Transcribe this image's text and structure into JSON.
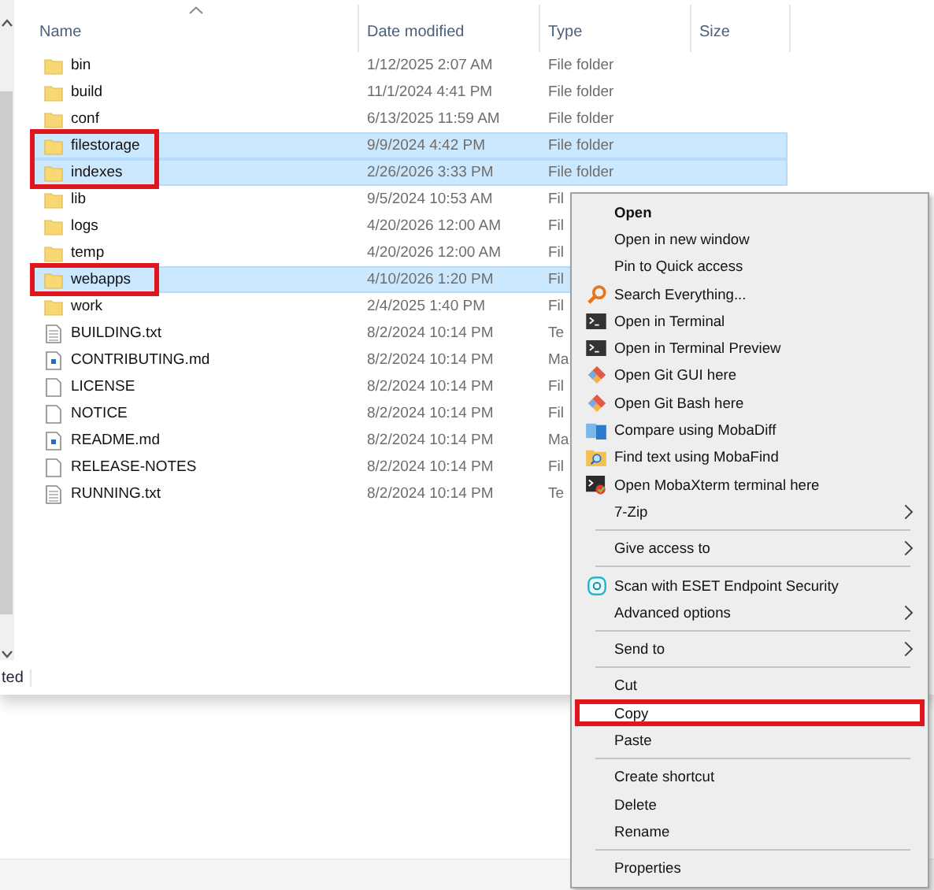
{
  "columns": [
    {
      "label": "Name",
      "sorted": true
    },
    {
      "label": "Date modified",
      "sorted": false
    },
    {
      "label": "Type",
      "sorted": false
    },
    {
      "label": "Size",
      "sorted": false
    }
  ],
  "files": [
    {
      "name": "bin",
      "date": "1/12/2025 2:07 AM",
      "type": "File folder",
      "kind": "folder",
      "selected": false,
      "annotated": false
    },
    {
      "name": "build",
      "date": "11/1/2024 4:41 PM",
      "type": "File folder",
      "kind": "folder",
      "selected": false,
      "annotated": false
    },
    {
      "name": "conf",
      "date": "6/13/2025 11:59 AM",
      "type": "File folder",
      "kind": "folder",
      "selected": false,
      "annotated": false
    },
    {
      "name": "filestorage",
      "date": "9/9/2024 4:42 PM",
      "type": "File folder",
      "kind": "folder",
      "selected": true,
      "annotated": true
    },
    {
      "name": "indexes",
      "date": "2/26/2026 3:33 PM",
      "type": "File folder",
      "kind": "folder",
      "selected": true,
      "annotated": true
    },
    {
      "name": "lib",
      "date": "9/5/2024 10:53 AM",
      "type": "Fil",
      "kind": "folder",
      "selected": false,
      "annotated": false
    },
    {
      "name": "logs",
      "date": "4/20/2026 12:00 AM",
      "type": "Fil",
      "kind": "folder",
      "selected": false,
      "annotated": false
    },
    {
      "name": "temp",
      "date": "4/20/2026 12:00 AM",
      "type": "Fil",
      "kind": "folder",
      "selected": false,
      "annotated": false
    },
    {
      "name": "webapps",
      "date": "4/10/2026 1:20 PM",
      "type": "Fil",
      "kind": "folder",
      "selected": true,
      "annotated": true
    },
    {
      "name": "work",
      "date": "2/4/2025 1:40 PM",
      "type": "Fil",
      "kind": "folder",
      "selected": false,
      "annotated": false
    },
    {
      "name": "BUILDING.txt",
      "date": "8/2/2024 10:14 PM",
      "type": "Te",
      "kind": "text",
      "selected": false,
      "annotated": false
    },
    {
      "name": "CONTRIBUTING.md",
      "date": "8/2/2024 10:14 PM",
      "type": "Ma",
      "kind": "markdown",
      "selected": false,
      "annotated": false
    },
    {
      "name": "LICENSE",
      "date": "8/2/2024 10:14 PM",
      "type": "Fil",
      "kind": "blank",
      "selected": false,
      "annotated": false
    },
    {
      "name": "NOTICE",
      "date": "8/2/2024 10:14 PM",
      "type": "Fil",
      "kind": "blank",
      "selected": false,
      "annotated": false
    },
    {
      "name": "README.md",
      "date": "8/2/2024 10:14 PM",
      "type": "Ma",
      "kind": "markdown",
      "selected": false,
      "annotated": false
    },
    {
      "name": "RELEASE-NOTES",
      "date": "8/2/2024 10:14 PM",
      "type": "Fil",
      "kind": "blank",
      "selected": false,
      "annotated": false
    },
    {
      "name": "RUNNING.txt",
      "date": "8/2/2024 10:14 PM",
      "type": "Te",
      "kind": "text",
      "selected": false,
      "annotated": false
    }
  ],
  "status_bar": {
    "text": "ted"
  },
  "context_menu": [
    {
      "kind": "item",
      "label": "Open",
      "default": true,
      "submenu": false,
      "selected": false,
      "annotated": false
    },
    {
      "kind": "item",
      "label": "Open in new window",
      "default": false,
      "submenu": false,
      "selected": false,
      "annotated": false
    },
    {
      "kind": "item",
      "label": "Pin to Quick access",
      "default": false,
      "submenu": false,
      "selected": false,
      "annotated": false
    },
    {
      "kind": "search",
      "label": "Search Everything...",
      "default": false,
      "submenu": false,
      "selected": false,
      "annotated": false
    },
    {
      "kind": "terminal",
      "label": "Open in Terminal",
      "default": false,
      "submenu": false,
      "selected": false,
      "annotated": false
    },
    {
      "kind": "terminal",
      "label": "Open in Terminal Preview",
      "default": false,
      "submenu": false,
      "selected": false,
      "annotated": false
    },
    {
      "kind": "git",
      "label": "Open Git GUI here",
      "default": false,
      "submenu": false,
      "selected": false,
      "annotated": false
    },
    {
      "kind": "git",
      "label": "Open Git Bash here",
      "default": false,
      "submenu": false,
      "selected": false,
      "annotated": false
    },
    {
      "kind": "compare",
      "label": "Compare using MobaDiff",
      "default": false,
      "submenu": false,
      "selected": false,
      "annotated": false
    },
    {
      "kind": "find",
      "label": "Find text using MobaFind",
      "default": false,
      "submenu": false,
      "selected": false,
      "annotated": false
    },
    {
      "kind": "mobaxterm",
      "label": "Open MobaXterm terminal here",
      "default": false,
      "submenu": false,
      "selected": false,
      "annotated": false
    },
    {
      "kind": "item",
      "label": "7-Zip",
      "default": false,
      "submenu": true,
      "selected": false,
      "annotated": false
    },
    {
      "kind": "separator"
    },
    {
      "kind": "item",
      "label": "Give access to",
      "default": false,
      "submenu": true,
      "selected": false,
      "annotated": false
    },
    {
      "kind": "separator"
    },
    {
      "kind": "eset",
      "label": "Scan with ESET Endpoint Security",
      "default": false,
      "submenu": false,
      "selected": false,
      "annotated": false
    },
    {
      "kind": "item",
      "label": "Advanced options",
      "default": false,
      "submenu": true,
      "selected": false,
      "annotated": false
    },
    {
      "kind": "separator"
    },
    {
      "kind": "item",
      "label": "Send to",
      "default": false,
      "submenu": true,
      "selected": false,
      "annotated": false
    },
    {
      "kind": "separator"
    },
    {
      "kind": "item",
      "label": "Cut",
      "default": false,
      "submenu": false,
      "selected": false,
      "annotated": false
    },
    {
      "kind": "item",
      "label": "Copy",
      "default": false,
      "submenu": false,
      "selected": true,
      "annotated": true
    },
    {
      "kind": "item",
      "label": "Paste",
      "default": false,
      "submenu": false,
      "selected": false,
      "annotated": false
    },
    {
      "kind": "separator"
    },
    {
      "kind": "item",
      "label": "Create shortcut",
      "default": false,
      "submenu": false,
      "selected": false,
      "annotated": false
    },
    {
      "kind": "item",
      "label": "Delete",
      "default": false,
      "submenu": false,
      "selected": false,
      "annotated": false
    },
    {
      "kind": "item",
      "label": "Rename",
      "default": false,
      "submenu": false,
      "selected": false,
      "annotated": false
    },
    {
      "kind": "separator"
    },
    {
      "kind": "item",
      "label": "Properties",
      "default": false,
      "submenu": false,
      "selected": false,
      "annotated": false
    }
  ]
}
